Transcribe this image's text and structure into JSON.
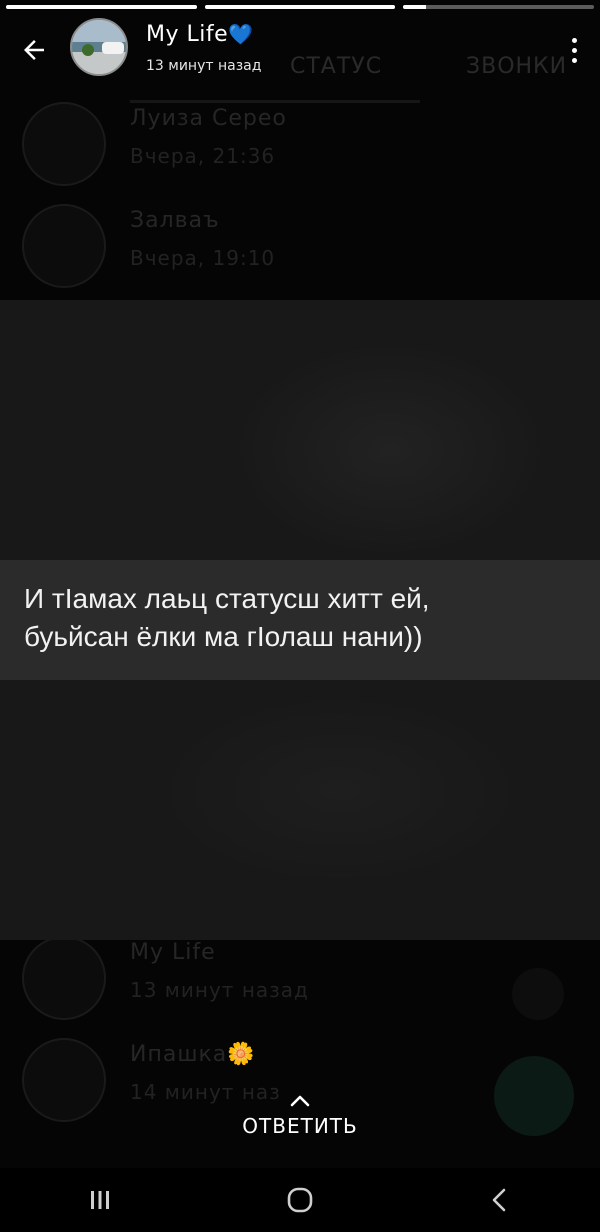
{
  "progress": {
    "segments": [
      {
        "fill": 1.0
      },
      {
        "fill": 1.0
      },
      {
        "fill": 0.12
      }
    ]
  },
  "header": {
    "contact_name": "My Life",
    "contact_name_emoji": "💙",
    "time_ago": "13 минут назад",
    "back_icon": "arrow-left-icon",
    "menu_icon": "more-vert-icon"
  },
  "background_list": {
    "tabs": [
      "СТАТУС",
      "ЗВОНКИ"
    ],
    "items": [
      {
        "name": "Луиза Серео",
        "time": "Вчера, 21:36"
      },
      {
        "name": "Залваъ",
        "time": "Вчера, 19:10"
      },
      {
        "name": "My Life",
        "time": "13 минут назад"
      },
      {
        "name": "Ипашка🌼",
        "time": "14 минут наз"
      }
    ]
  },
  "status": {
    "caption": "И тIамах лаьц статусш хитт ей,\nбуьйсан ёлки ма гIолаш нани))"
  },
  "reply": {
    "label": "ОТВЕТИТЬ",
    "icon": "chevron-up-icon"
  },
  "navbar": {
    "recents_icon": "recents-icon",
    "home_icon": "home-icon",
    "back_icon": "back-chevron-icon"
  },
  "colors": {
    "background": "#050505",
    "status_panel": "#181818",
    "caption_band": "#2b2b2b",
    "heart": "#2b3a67"
  }
}
